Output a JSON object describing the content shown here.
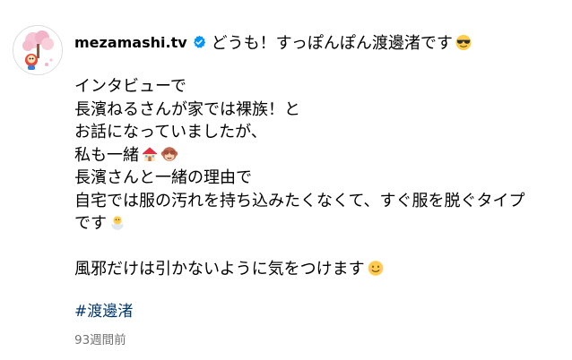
{
  "post": {
    "username": "mezamashi.tv",
    "first_line": "どうも！すっぽんぽん渡邊渚です",
    "lines": [
      {
        "text": "インタビューで"
      },
      {
        "text": "長濱ねるさんが家では裸族！と"
      },
      {
        "text": "お話になっていましたが、"
      },
      {
        "text": "私も一緒"
      },
      {
        "text": "長濱さんと一緒の理由で"
      },
      {
        "text": "自宅では服の汚れを持ち込みたくなくて、すぐ服を脱ぐタイプ"
      },
      {
        "text": "です"
      }
    ],
    "closing_line": "風邪だけは引かないように気をつけます",
    "hashtag": "#渡邊渚",
    "timestamp": "93週間前"
  },
  "icons": {
    "avatar": "mezamashi-mascot-avatar",
    "verified": "verified-badge-icon",
    "emoji_1": "sunglasses-face-emoji",
    "emoji_2": "house-emoji",
    "emoji_3": "see-no-evil-monkey-emoji",
    "emoji_4": "hatching-chick-emoji",
    "emoji_5": "smiling-face-emoji"
  },
  "colors": {
    "text": "#000000",
    "hashtag": "#00376b",
    "timestamp": "#737373",
    "verified": "#0095f6"
  }
}
